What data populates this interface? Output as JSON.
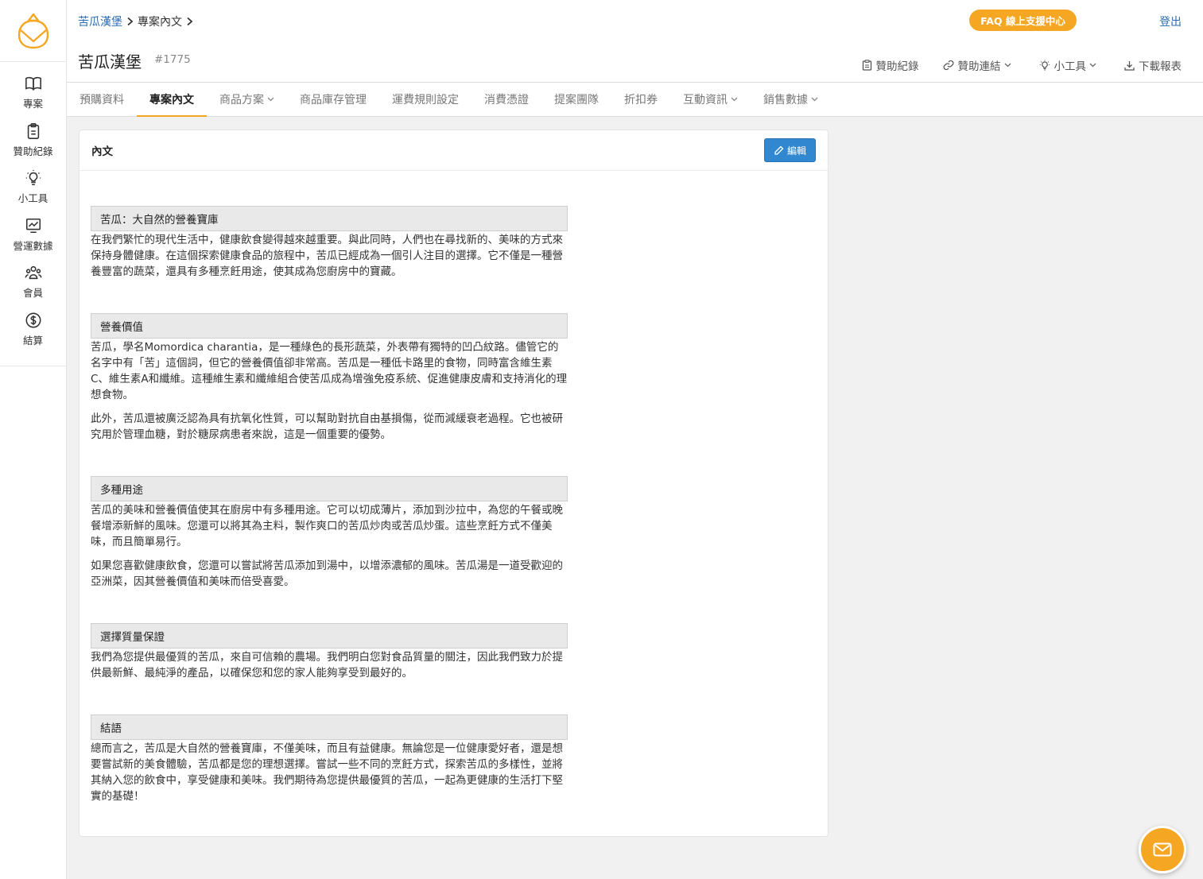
{
  "sidebar": {
    "items": [
      {
        "label": "專案",
        "icon": "book-icon"
      },
      {
        "label": "贊助紀錄",
        "icon": "clipboard-icon"
      },
      {
        "label": "小工具",
        "icon": "lightbulb-icon"
      },
      {
        "label": "營運數據",
        "icon": "chart-icon"
      },
      {
        "label": "會員",
        "icon": "users-icon"
      },
      {
        "label": "結算",
        "icon": "dollar-icon"
      }
    ]
  },
  "header": {
    "breadcrumb": [
      "苦瓜漢堡",
      "專案內文"
    ],
    "faq_label": "FAQ 線上支援中心",
    "logout_label": "登出",
    "title": "苦瓜漢堡",
    "project_id": "#1775",
    "tools": [
      "贊助紀錄",
      "贊助連結",
      "小工具",
      "下載報表"
    ]
  },
  "tabs": [
    "預購資料",
    "專案內文",
    "商品方案",
    "商品庫存管理",
    "運費規則設定",
    "消費憑證",
    "提案團隊",
    "折扣券",
    "互動資訊",
    "銷售數據"
  ],
  "active_tab": "專案內文",
  "card": {
    "title": "內文",
    "edit_label": "編輯",
    "sections": [
      {
        "heading": "苦瓜：大自然的營養寶庫",
        "paragraphs": [
          "在我們繁忙的現代生活中，健康飲食變得越來越重要。與此同時，人們也在尋找新的、美味的方式來保持身體健康。在這個探索健康食品的旅程中，苦瓜已經成為一個引人注目的選擇。它不僅是一種營養豐富的蔬菜，還具有多種烹飪用途，使其成為您廚房中的寶藏。"
        ]
      },
      {
        "heading": "營養價值",
        "paragraphs": [
          "苦瓜，學名Momordica charantia，是一種綠色的長形蔬菜，外表帶有獨特的凹凸紋路。儘管它的名字中有「苦」這個詞，但它的營養價值卻非常高。苦瓜是一種低卡路里的食物，同時富含維生素C、維生素A和纖維。這種維生素和纖維組合使苦瓜成為增強免疫系統、促進健康皮膚和支持消化的理想食物。",
          "此外，苦瓜還被廣泛認為具有抗氧化性質，可以幫助對抗自由基損傷，從而減緩衰老過程。它也被研究用於管理血糖，對於糖尿病患者來說，這是一個重要的優勢。"
        ]
      },
      {
        "heading": "多種用途",
        "paragraphs": [
          "苦瓜的美味和營養價值使其在廚房中有多種用途。它可以切成薄片，添加到沙拉中，為您的午餐或晚餐增添新鮮的風味。您還可以將其為主料，製作爽口的苦瓜炒肉或苦瓜炒蛋。這些烹飪方式不僅美味，而且簡單易行。",
          "如果您喜歡健康飲食，您還可以嘗試將苦瓜添加到湯中，以增添濃郁的風味。苦瓜湯是一道受歡迎的亞洲菜，因其營養價值和美味而倍受喜愛。"
        ]
      },
      {
        "heading": "選擇質量保證",
        "paragraphs": [
          "我們為您提供最優質的苦瓜，來自可信賴的農場。我們明白您對食品質量的關注，因此我們致力於提供最新鮮、最純淨的產品，以確保您和您的家人能夠享受到最好的。"
        ]
      },
      {
        "heading": "結語",
        "paragraphs": [
          "總而言之，苦瓜是大自然的營養寶庫，不僅美味，而且有益健康。無論您是一位健康愛好者，還是想要嘗試新的美食體驗，苦瓜都是您的理想選擇。嘗試一些不同的烹飪方式，探索苦瓜的多樣性，並將其納入您的飲食中，享受健康和美味。我們期待為您提供最優質的苦瓜，一起為更健康的生活打下堅實的基礎！"
        ]
      }
    ]
  },
  "colors": {
    "accent": "#f5a623",
    "link": "#2b6cb0",
    "edit_button": "#3288d0"
  }
}
